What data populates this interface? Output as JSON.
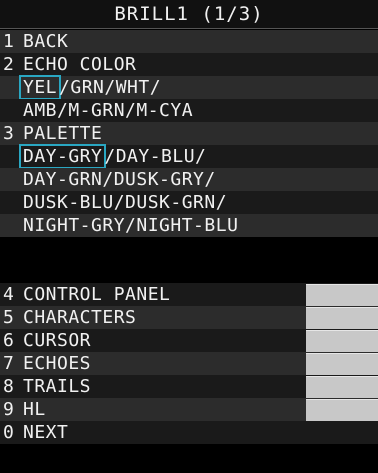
{
  "title": "BRILL1 (1/3)",
  "items": {
    "back": {
      "num": "1",
      "label": "BACK"
    },
    "echo_color": {
      "num": "2",
      "label": "ECHO COLOR",
      "options_line1_selected": "YEL",
      "options_line1_rest": "/GRN/WHT/",
      "options_line2": "AMB/M-GRN/M-CYA"
    },
    "palette": {
      "num": "3",
      "label": "PALETTE",
      "line1_selected": "DAY-GRY",
      "line1_rest": "/DAY-BLU/",
      "line2": "DAY-GRN/DUSK-GRY/",
      "line3": "DUSK-BLU/DUSK-GRN/",
      "line4": "NIGHT-GRY/NIGHT-BLU"
    },
    "control_panel": {
      "num": "4",
      "label": "CONTROL PANEL"
    },
    "characters": {
      "num": "5",
      "label": "CHARACTERS"
    },
    "cursor": {
      "num": "6",
      "label": "CURSOR"
    },
    "echoes": {
      "num": "7",
      "label": "ECHOES"
    },
    "trails": {
      "num": "8",
      "label": "TRAILS"
    },
    "hl": {
      "num": "9",
      "label": "HL"
    },
    "next": {
      "num": "0",
      "label": "NEXT"
    }
  }
}
